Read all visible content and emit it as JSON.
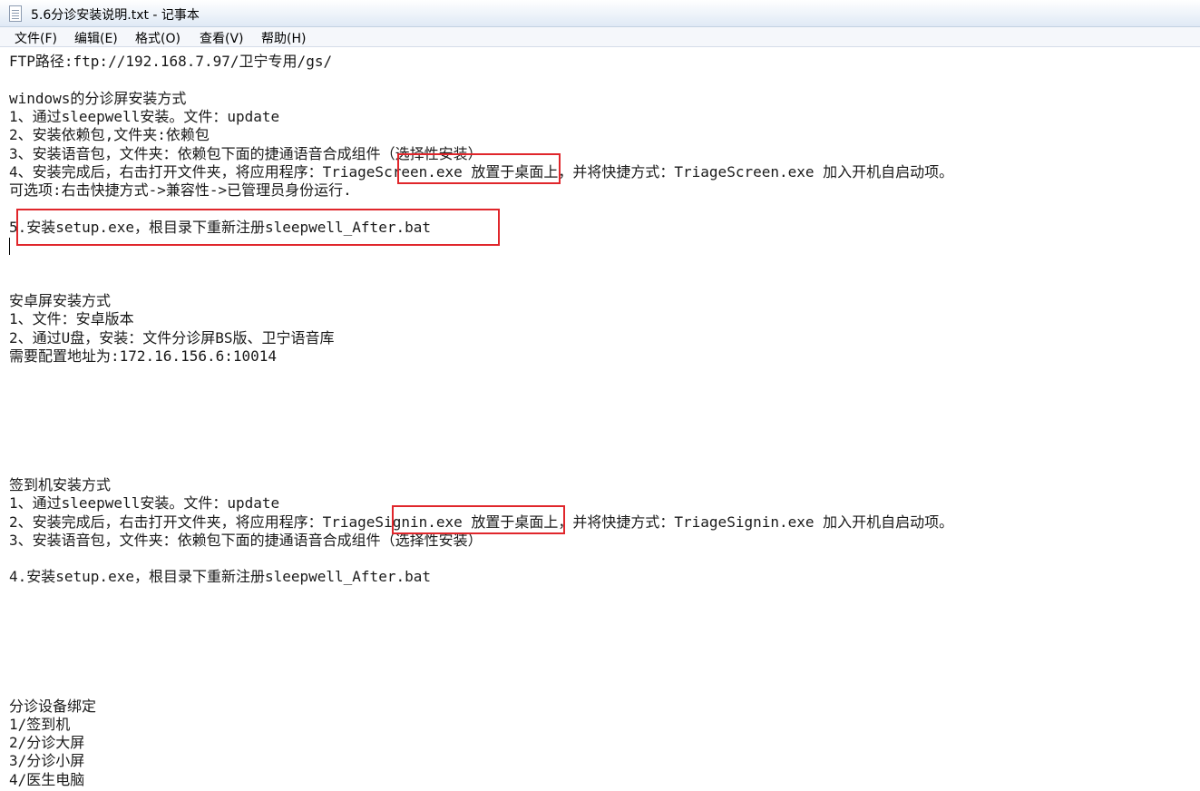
{
  "window": {
    "title": "5.6分诊安装说明.txt - 记事本",
    "icon": "notepad-document-icon"
  },
  "menu": [
    {
      "label": "文件(F)"
    },
    {
      "label": "编辑(E)"
    },
    {
      "label": "格式(O)"
    },
    {
      "label": "查看(V)"
    },
    {
      "label": "帮助(H)"
    }
  ],
  "content": {
    "lines": [
      "FTP路径:ftp://192.168.7.97/卫宁专用/gs/",
      "",
      "windows的分诊屏安装方式",
      "1、通过sleepwell安装。文件：update",
      "2、安装依赖包,文件夹:依赖包",
      "3、安装语音包，文件夹：依赖包下面的捷通语音合成组件（选择性安装）",
      "4、安装完成后，右击打开文件夹，将应用程序：TriageScreen.exe 放置于桌面上，并将快捷方式：TriageScreen.exe 加入开机自启动项。",
      "可选项:右击快捷方式->兼容性->已管理员身份运行.",
      "",
      "5.安装setup.exe，根目录下重新注册sleepwell_After.bat",
      "",
      "",
      "",
      "安卓屏安装方式",
      "1、文件：安卓版本",
      "2、通过U盘，安装：文件分诊屏BS版、卫宁语音库",
      "需要配置地址为:172.16.156.6:10014",
      "",
      "",
      "",
      "",
      "",
      "",
      "签到机安装方式",
      "1、通过sleepwell安装。文件：update",
      "2、安装完成后，右击打开文件夹，将应用程序：TriageSignin.exe 放置于桌面上，并将快捷方式：TriageSignin.exe 加入开机自启动项。",
      "3、安装语音包，文件夹：依赖包下面的捷通语音合成组件（选择性安装）",
      "",
      "4.安装setup.exe，根目录下重新注册sleepwell_After.bat",
      "",
      "",
      "",
      "",
      "",
      "",
      "分诊设备绑定",
      "1/签到机",
      "2/分诊大屏",
      "3/分诊小屏",
      "4/医生电脑"
    ]
  },
  "annotations": {
    "color": "#e0262b"
  }
}
